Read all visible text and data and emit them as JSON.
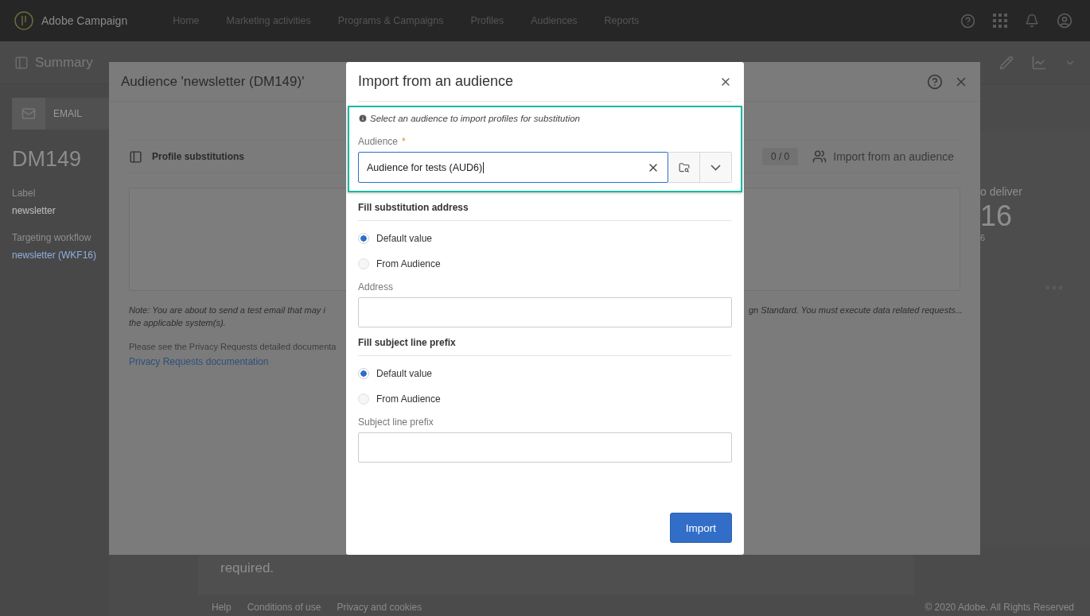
{
  "top_nav": {
    "brand": "Adobe Campaign",
    "items": [
      {
        "label": "Home"
      },
      {
        "label": "Marketing activities"
      },
      {
        "label": "Programs & Campaigns"
      },
      {
        "label": "Profiles"
      },
      {
        "label": "Audiences"
      },
      {
        "label": "Reports"
      }
    ]
  },
  "page_header": {
    "title": "Summary"
  },
  "sidebar": {
    "tab": "EMAIL",
    "code": "DM149",
    "fields": [
      {
        "label": "Label",
        "value": "newsletter",
        "kind": "text"
      },
      {
        "label": "Targeting workflow",
        "value": "newsletter (WKF16)",
        "kind": "link"
      }
    ]
  },
  "stats": {
    "label": "o deliver",
    "value": "16",
    "sub": "6"
  },
  "background_card": {
    "text": "required."
  },
  "footer": {
    "links": [
      "Help",
      "Conditions of use",
      "Privacy and cookies"
    ],
    "copyright": "© 2020 Adobe. All Rights Reserved"
  },
  "audience_dialog": {
    "title": "Audience 'newsletter (DM149)'",
    "section": {
      "title": "Profile substitutions",
      "count": "0 / 0",
      "action": "Import from an audience"
    },
    "note_left": [
      "Note: You are about to send a test email that may i",
      "the applicable system(s)."
    ],
    "note_right": "gn Standard. You must execute data related requests...",
    "privacy_text": "Please see the Privacy Requests detailed documenta",
    "privacy_link": "Privacy Requests documentation"
  },
  "import_dialog": {
    "title": "Import from an audience",
    "hint": "Select an audience to import profiles for substitution",
    "audience_field": {
      "label": "Audience",
      "required_mark": "*",
      "value": "Audience for tests (AUD6)"
    },
    "groups": [
      {
        "title": "Fill substitution address",
        "options": [
          {
            "label": "Default value",
            "selected": true
          },
          {
            "label": "From Audience",
            "selected": false
          }
        ],
        "field_label": "Address"
      },
      {
        "title": "Fill subject line prefix",
        "options": [
          {
            "label": "Default value",
            "selected": true
          },
          {
            "label": "From Audience",
            "selected": false
          }
        ],
        "field_label": "Subject line prefix"
      }
    ],
    "button": "Import"
  }
}
